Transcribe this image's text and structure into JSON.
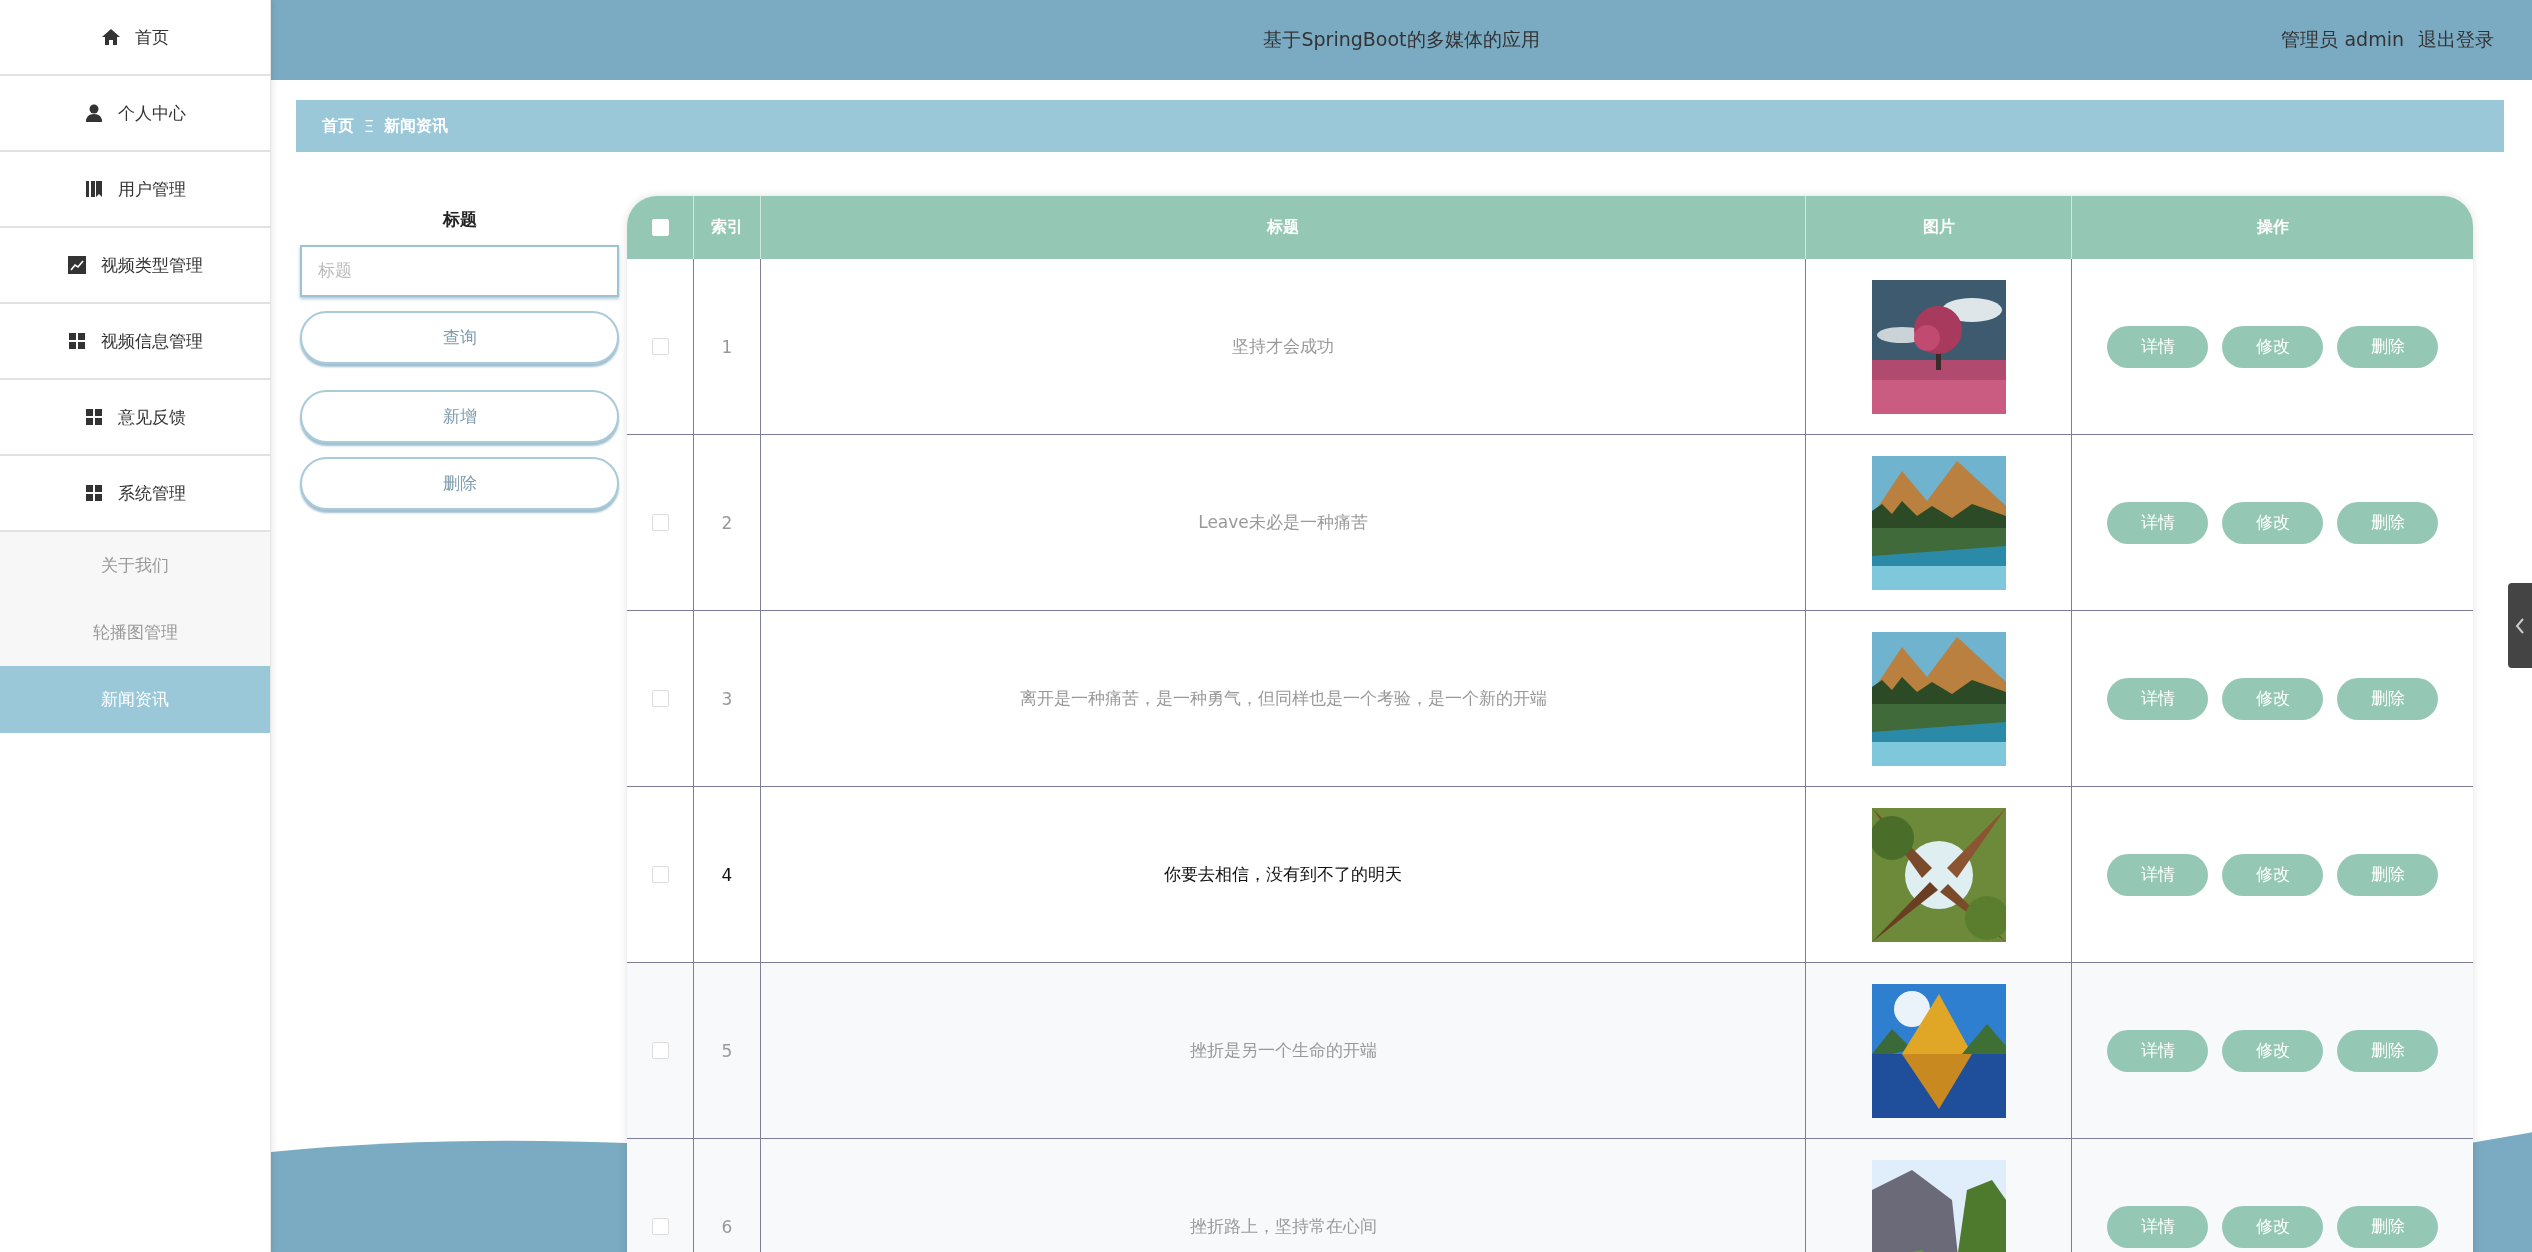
{
  "sidebar": {
    "items": [
      {
        "label": "首页",
        "selected": false
      },
      {
        "label": "个人中心",
        "selected": false
      },
      {
        "label": "用户管理",
        "selected": false
      },
      {
        "label": "视频类型管理",
        "selected": false
      },
      {
        "label": "视频信息管理",
        "selected": false
      },
      {
        "label": "意见反馈",
        "selected": false
      },
      {
        "label": "系统管理",
        "selected": false
      }
    ],
    "sub_items": [
      {
        "label": "关于我们",
        "selected": false
      },
      {
        "label": "轮播图管理",
        "selected": false
      },
      {
        "label": "新闻资讯",
        "selected": true
      }
    ]
  },
  "header": {
    "title": "基于SpringBoot的多媒体的应用",
    "user": "管理员 admin",
    "logout": "退出登录"
  },
  "breadcrumb": {
    "home": "首页",
    "separator": "Ξ",
    "current": "新闻资讯"
  },
  "search": {
    "label": "标题",
    "placeholder": "标题",
    "buttons": [
      "查询",
      "新增",
      "删除"
    ]
  },
  "table": {
    "select_all": {
      "checked": false
    },
    "columns": [
      "索引",
      "标题",
      "图片",
      "操作"
    ],
    "rows": [
      {
        "index": "1",
        "title": "坚持才会成功",
        "checked": false,
        "hovered": false,
        "actions": [
          "详情",
          "修改",
          "删除"
        ]
      },
      {
        "index": "2",
        "title": "Leave未必是一种痛苦",
        "checked": false,
        "hovered": false,
        "actions": [
          "详情",
          "修改",
          "删除"
        ]
      },
      {
        "index": "3",
        "title": "离开是一种痛苦，是一种勇气，但同样也是一个考验，是一个新的开端",
        "checked": false,
        "hovered": false,
        "actions": [
          "详情",
          "修改",
          "删除"
        ]
      },
      {
        "index": "4",
        "title": "你要去相信，没有到不了的明天",
        "checked": false,
        "hovered": true,
        "actions": [
          "详情",
          "修改",
          "删除"
        ]
      },
      {
        "index": "5",
        "title": "挫折是另一个生命的开端",
        "checked": false,
        "hovered": false,
        "actions": [
          "详情",
          "修改",
          "删除"
        ]
      },
      {
        "index": "6",
        "title": "挫折路上，坚持常在心间",
        "checked": false,
        "hovered": false,
        "actions": [
          "详情",
          "修改",
          "删除"
        ]
      }
    ]
  }
}
